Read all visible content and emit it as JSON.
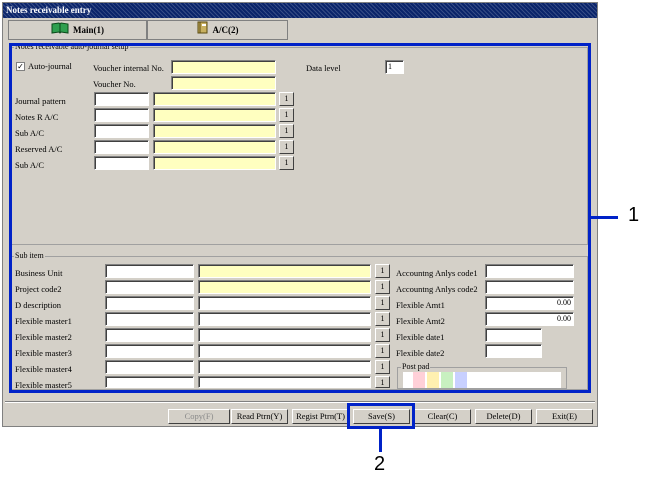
{
  "window": {
    "title": "Notes receivable entry"
  },
  "tabs": [
    {
      "label": "Main(1)"
    },
    {
      "label": "A/C(2)"
    }
  ],
  "setup_group": {
    "title": "Notes receivable auto-journal setup",
    "auto_journal": {
      "label": "Auto-journal",
      "checked": true
    },
    "voucher_internal_no": {
      "label": "Voucher internal No.",
      "value": ""
    },
    "voucher_no": {
      "label": "Voucher No.",
      "value": ""
    },
    "data_level": {
      "label": "Data level",
      "value": "1"
    },
    "rows": [
      {
        "label": "Journal pattern"
      },
      {
        "label": "Notes R A/C"
      },
      {
        "label": "Sub A/C"
      },
      {
        "label": "Reserved A/C"
      },
      {
        "label": "Sub A/C"
      }
    ],
    "lookup_label": "1"
  },
  "sub_item_group": {
    "title": "Sub item",
    "rows": [
      {
        "label": "Business Unit"
      },
      {
        "label": "Project code2"
      },
      {
        "label": "D description"
      },
      {
        "label": "Flexible master1"
      },
      {
        "label": "Flexible master2"
      },
      {
        "label": "Flexible master3"
      },
      {
        "label": "Flexible master4"
      },
      {
        "label": "Flexible master5"
      }
    ],
    "right_rows": [
      {
        "label": "Accountng Anlys code1",
        "value": ""
      },
      {
        "label": "Accountng Anlys code2",
        "value": ""
      },
      {
        "label": "Flexible Amt1",
        "value": "0.00"
      },
      {
        "label": "Flexible Amt2",
        "value": "0.00"
      },
      {
        "label": "Flexible date1",
        "value": ""
      },
      {
        "label": "Flexible date2",
        "value": ""
      }
    ],
    "post_pad": {
      "label": "Post pad"
    }
  },
  "buttons": {
    "copy": "Copy(F)",
    "read_ptrn": "Read Ptrn(Y)",
    "regist_ptrn": "Regist Ptrn(T)",
    "save": "Save(S)",
    "clear": "Clear(C)",
    "delete": "Delete(D)",
    "exit": "Exit(E)"
  },
  "callouts": {
    "one": "1",
    "two": "2"
  },
  "colors": {
    "callout": "#0022c8",
    "title_bar": "#0a246a",
    "input_required": "#ffffc0"
  }
}
